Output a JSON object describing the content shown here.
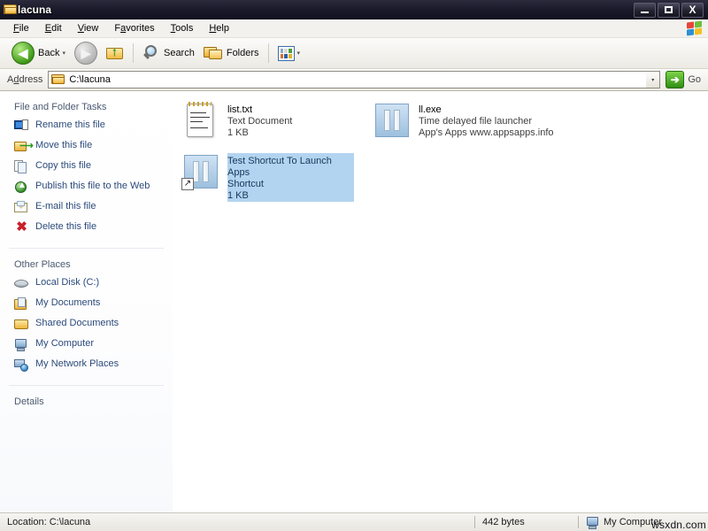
{
  "window": {
    "title": "lacuna",
    "folder_icon": "folder-icon",
    "controls": {
      "minimize": "minimize-button",
      "maximize": "maximize-button",
      "close": "X"
    }
  },
  "menu": {
    "items": [
      {
        "label": "File",
        "accel": "F"
      },
      {
        "label": "Edit",
        "accel": "E"
      },
      {
        "label": "View",
        "accel": "V"
      },
      {
        "label": "Favorites",
        "accel": "a"
      },
      {
        "label": "Tools",
        "accel": "T"
      },
      {
        "label": "Help",
        "accel": "H"
      }
    ],
    "logo": "windows-flag-icon"
  },
  "toolbar": {
    "back_label": "Back",
    "forward_label": "",
    "up_label": "",
    "search_label": "Search",
    "folders_label": "Folders",
    "views_label": "",
    "back_arrow": "◀",
    "forward_arrow": "▶",
    "up_arrow": "↑",
    "dropdown_chevron": "▾"
  },
  "address": {
    "label": "Address",
    "accel": "d",
    "value": "C:\\lacuna",
    "dropdown": "▾",
    "go_label": "Go",
    "go_arrow": "➔"
  },
  "sidebar": {
    "panels": [
      {
        "title": "File and Folder Tasks",
        "items": [
          {
            "label": "Rename this file",
            "icon": "rename-icon"
          },
          {
            "label": "Move this file",
            "icon": "move-icon"
          },
          {
            "label": "Copy this file",
            "icon": "copy-icon"
          },
          {
            "label": "Publish this file to the Web",
            "icon": "publish-web-icon"
          },
          {
            "label": "E-mail this file",
            "icon": "email-icon"
          },
          {
            "label": "Delete this file",
            "icon": "delete-icon"
          }
        ]
      },
      {
        "title": "Other Places",
        "items": [
          {
            "label": "Local Disk (C:)",
            "icon": "local-disk-icon"
          },
          {
            "label": "My Documents",
            "icon": "my-documents-icon"
          },
          {
            "label": "Shared Documents",
            "icon": "shared-documents-icon"
          },
          {
            "label": "My Computer",
            "icon": "my-computer-icon"
          },
          {
            "label": "My Network Places",
            "icon": "my-network-places-icon"
          }
        ]
      },
      {
        "title": "Details",
        "items": []
      }
    ]
  },
  "files": [
    {
      "name": "list.txt",
      "line2": "Text Document",
      "line3": "1 KB",
      "icon": "text-document-icon",
      "selected": false,
      "shortcut": false
    },
    {
      "name": "ll.exe",
      "line2": "Time delayed file launcher",
      "line3": "App's Apps  www.appsapps.info",
      "icon": "application-icon",
      "selected": false,
      "shortcut": false
    },
    {
      "name": "Test Shortcut To Launch Apps",
      "line2": "Shortcut",
      "line3": "1 KB",
      "icon": "application-icon",
      "selected": true,
      "shortcut": true,
      "shortcut_glyph": "↗"
    }
  ],
  "statusbar": {
    "location": "Location: C:\\lacuna",
    "size": "442 bytes",
    "zone": "My Computer",
    "zone_icon": "my-computer-icon",
    "watermark": "wsxdn.com"
  },
  "colors": {
    "title_bar": "#1b1b2b",
    "selection": "#b3d4f0",
    "task_link": "#2b4a7a",
    "panel_head": "#4a5a70"
  }
}
